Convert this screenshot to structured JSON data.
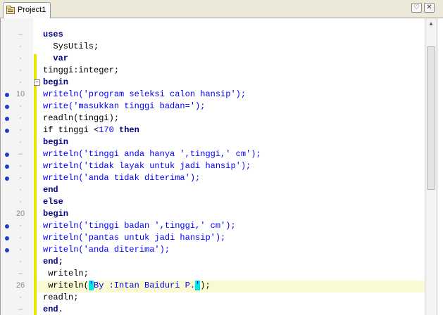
{
  "tab": {
    "label": "Project1"
  },
  "window": {
    "restore_glyph": "♡",
    "close_glyph": "✕"
  },
  "gutter": {
    "line_numbers": [
      "10",
      "20",
      "26"
    ]
  },
  "code": {
    "l1": "uses",
    "l2": "  SysUtils;",
    "l3": "  var",
    "l4": "tinggi:integer;",
    "l5": "begin",
    "l6": "writeln('program seleksi calon hansip');",
    "l7": "write('masukkan tinggi badan=');",
    "l8": "readln(tinggi);",
    "l9a": "if tinggi <",
    "l9b": "170",
    "l9c": " then",
    "l10": "begin",
    "l11": "writeln('tinggi anda hanya ',tinggi,' cm');",
    "l12": "writeln('tidak layak untuk jadi hansip');",
    "l13": "writeln('anda tidak diterima');",
    "l14": "end",
    "l15": "else",
    "l16": "begin",
    "l17": "writeln('tinggi badan ',tinggi,' cm');",
    "l18": "writeln('pantas untuk jadi hansip');",
    "l19": "writeln('anda diterima');",
    "l20": "end;",
    "l21": " writeln;",
    "l22a": " writeln(",
    "l22b": "'",
    "l22c": "By :Intan Baiduri P.",
    "l22d": "'",
    "l22e": ");",
    "l23": "readln;",
    "l24": "end."
  },
  "colors": {
    "keyword": "#000080",
    "string": "#0000ff",
    "modified_bar": "#e5e500",
    "bracket_highlight": "#00e5e5",
    "breakpoint": "#1b3fbf"
  }
}
